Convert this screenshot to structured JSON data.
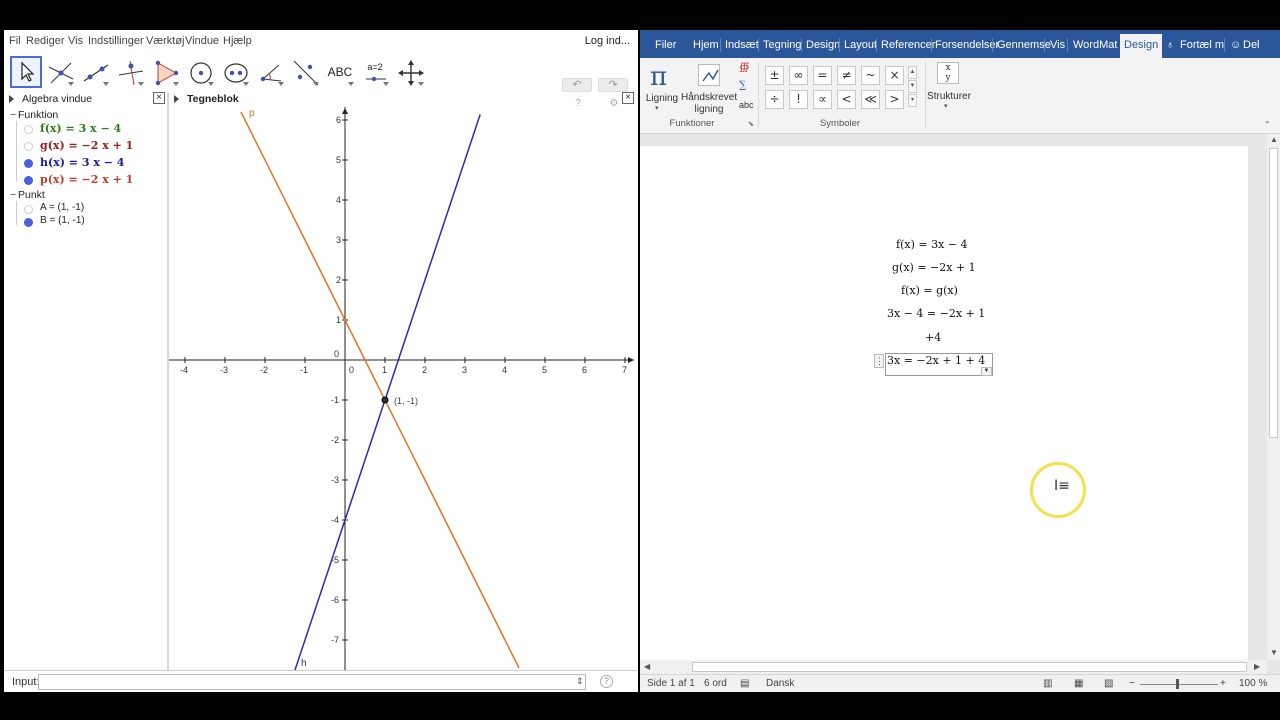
{
  "geogebra": {
    "menu": [
      "Fil",
      "Rediger",
      "Vis",
      "Indstillinger",
      "Værktøj",
      "Vindue",
      "Hjælp"
    ],
    "login": "Log ind...",
    "toolbar": {
      "tools": [
        "move-tool-icon",
        "point-tool-icon",
        "line-tool-icon",
        "perpendicular-line-icon",
        "polygon-tool-icon",
        "circle-tool-icon",
        "ellipse-tool-icon",
        "angle-tool-icon",
        "reflect-tool-icon",
        "text-tool-icon",
        "slider-tool-icon",
        "move-view-icon"
      ],
      "text_tool_label": "ABC",
      "slider_tool_label": "a=2",
      "undo_label": "↶",
      "redo_label": "↷"
    },
    "algebra": {
      "title": "Algebra vindue",
      "group_functions": "Funktion",
      "group_points": "Punkt",
      "functions": [
        {
          "text": "f(x)  =  3 x − 4",
          "color": "#2e7d1b",
          "shown": false
        },
        {
          "text": "g(x)  =  −2 x + 1",
          "color": "#a01818",
          "shown": false
        },
        {
          "text": "h(x)  =  3 x − 4",
          "color": "#1a1a9c",
          "shown": true
        },
        {
          "text": "p(x)  =  −2 x + 1",
          "color": "#c0392b",
          "shown": true
        }
      ],
      "points": [
        {
          "text": "A = (1, -1)",
          "shown": false
        },
        {
          "text": "B = (1, -1)",
          "shown": true
        }
      ]
    },
    "graphics": {
      "title": "Tegneblok",
      "x_ticks": [
        "-4",
        "-3",
        "-2",
        "-1",
        "0",
        "1",
        "2",
        "3",
        "4",
        "5",
        "6",
        "7"
      ],
      "y_ticks": [
        "6",
        "5",
        "4",
        "3",
        "2",
        "1",
        "0",
        "-1",
        "-2",
        "-3",
        "-4",
        "-5",
        "-6",
        "-7"
      ],
      "line_p_label": "p",
      "line_h_label": "h",
      "point_label": "(1, -1)",
      "line_p_color": "#e8731d",
      "line_h_color": "#2a2ab0"
    },
    "input": {
      "label": "Input:",
      "value": ""
    }
  },
  "word": {
    "tabs": [
      "Filer",
      "Hjem",
      "Indsæt",
      "Tegning",
      "Design",
      "Layout",
      "Referencer",
      "Forsendelser",
      "Gennemse",
      "Vis",
      "WordMat",
      "Design",
      "Fortæl m",
      "Del"
    ],
    "ribbon": {
      "ligning": "Ligning",
      "haandskrevet_1": "Håndskrevet",
      "haandskrevet_2": "ligning",
      "abc": "abc",
      "funktioner": "Funktioner",
      "symboler": "Symboler",
      "strukturer": "Strukturer",
      "symbols_row1": [
        "±",
        "∞",
        "=",
        "≠",
        "~",
        "×"
      ],
      "symbols_row2": [
        "÷",
        "!",
        "∝",
        "<",
        "≪",
        ">"
      ]
    },
    "equations": [
      "f(x) = 3x − 4",
      "g(x) = −2x + 1",
      "f(x) = g(x)",
      "3x − 4 = −2x + 1",
      "+4",
      "3x = −2x + 1 + 4"
    ],
    "status": {
      "page": "Side 1 af 1",
      "words": "6 ord",
      "language": "Dansk",
      "zoom": "100 %"
    }
  }
}
